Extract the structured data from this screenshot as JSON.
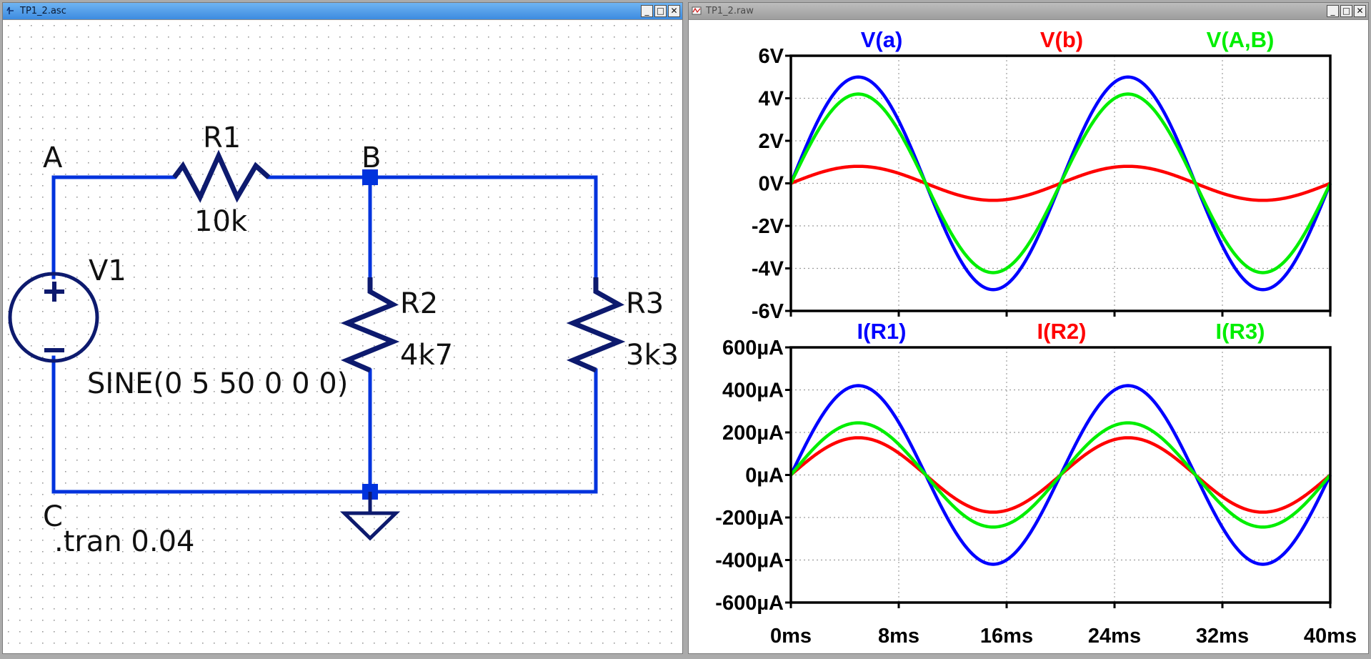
{
  "schematic_window": {
    "title": "TP1_2.asc",
    "controls": {
      "minimize": "_",
      "maximize": "□",
      "close": "✕"
    },
    "colors": {
      "wire": "#0033dd",
      "component": "#0d1a6e",
      "grid_dot": "#a0a0a0"
    },
    "nodes": {
      "a": "A",
      "b": "B",
      "c": "C"
    },
    "components": {
      "r1": {
        "name": "R1",
        "value": "10k"
      },
      "r2": {
        "name": "R2",
        "value": "4k7"
      },
      "r3": {
        "name": "R3",
        "value": "3k3"
      },
      "v1": {
        "name": "V1",
        "value": "SINE(0 5 50 0 0 0)"
      }
    },
    "directive": ".tran 0.04"
  },
  "waveform_window": {
    "title": "TP1_2.raw",
    "controls": {
      "minimize": "_",
      "maximize": "□",
      "close": "✕"
    },
    "x_ticks": [
      "0ms",
      "8ms",
      "16ms",
      "24ms",
      "32ms",
      "40ms"
    ],
    "voltage_pane": {
      "y_ticks": [
        "6V",
        "4V",
        "2V",
        "0V",
        "-2V",
        "-4V",
        "-6V"
      ],
      "traces": [
        {
          "label": "V(a)",
          "color": "#0000ff"
        },
        {
          "label": "V(b)",
          "color": "#ff0000"
        },
        {
          "label": "V(A,B)",
          "color": "#00ee00"
        }
      ]
    },
    "current_pane": {
      "y_ticks": [
        "600µA",
        "400µA",
        "200µA",
        "0µA",
        "-200µA",
        "-400µA",
        "-600µA"
      ],
      "traces": [
        {
          "label": "I(R1)",
          "color": "#0000ff"
        },
        {
          "label": "I(R2)",
          "color": "#ff0000"
        },
        {
          "label": "I(R3)",
          "color": "#00ee00"
        }
      ]
    }
  },
  "chart_data": [
    {
      "type": "line",
      "x_unit": "ms",
      "xlim": [
        0,
        40
      ],
      "ylim": [
        -6,
        6
      ],
      "y_unit": "V",
      "series": [
        {
          "name": "V(a)",
          "amplitude": 5,
          "frequency_hz": 50
        },
        {
          "name": "V(b)",
          "amplitude": 0.8,
          "frequency_hz": 50
        },
        {
          "name": "V(A,B)",
          "amplitude": 4.2,
          "frequency_hz": 50
        }
      ]
    },
    {
      "type": "line",
      "x_unit": "ms",
      "xlim": [
        0,
        40
      ],
      "ylim": [
        -600,
        600
      ],
      "y_unit": "µA",
      "series": [
        {
          "name": "I(R1)",
          "amplitude": 420,
          "frequency_hz": 50
        },
        {
          "name": "I(R2)",
          "amplitude": 175,
          "frequency_hz": 50
        },
        {
          "name": "I(R3)",
          "amplitude": 245,
          "frequency_hz": 50
        }
      ]
    }
  ]
}
